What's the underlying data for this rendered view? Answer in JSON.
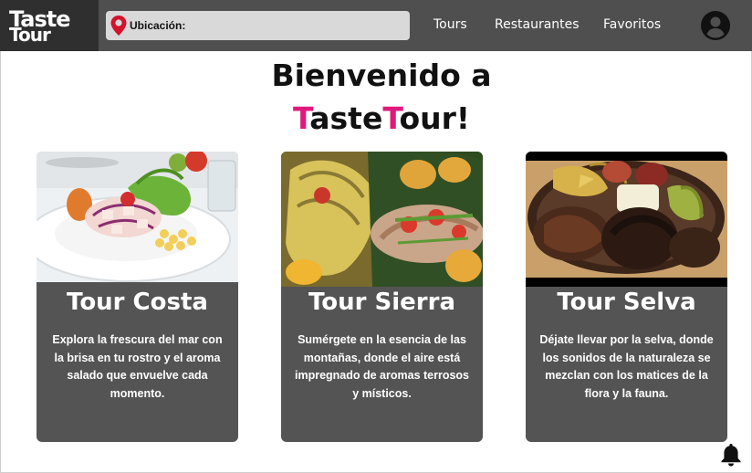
{
  "logo": {
    "line1": "Taste",
    "line2": "Tour"
  },
  "search": {
    "label": "Ubicación:",
    "icon": "location-pin-icon"
  },
  "nav": {
    "items": [
      {
        "label": "Tours"
      },
      {
        "label": "Restaurantes"
      },
      {
        "label": "Favoritos"
      }
    ]
  },
  "user_icon": "user-avatar-icon",
  "welcome": {
    "line1": "Bienvenido a",
    "brand_t1": "T",
    "brand_part1": "aste",
    "brand_t2": "T",
    "brand_part2": "our!"
  },
  "cards": [
    {
      "title": "Tour Costa",
      "description": "Explora la frescura del mar con la brisa en tu rostro y el aroma salado que envuelve cada momento."
    },
    {
      "title": "Tour Sierra",
      "description": "Sumérgete en la esencia de las montañas, donde el aire está impregnado de aromas terrosos y místicos."
    },
    {
      "title": "Tour Selva",
      "description": "Déjate llevar por la selva, donde los sonidos de la naturaleza se mezclan con los matices de la flora y la fauna."
    }
  ],
  "bell_icon": "notification-bell-icon",
  "colors": {
    "header_bg": "#4f4f4f",
    "logo_bg": "#2f2f2f",
    "card_bg": "#545454",
    "accent": "#e0197d",
    "pin": "#d3122b"
  }
}
